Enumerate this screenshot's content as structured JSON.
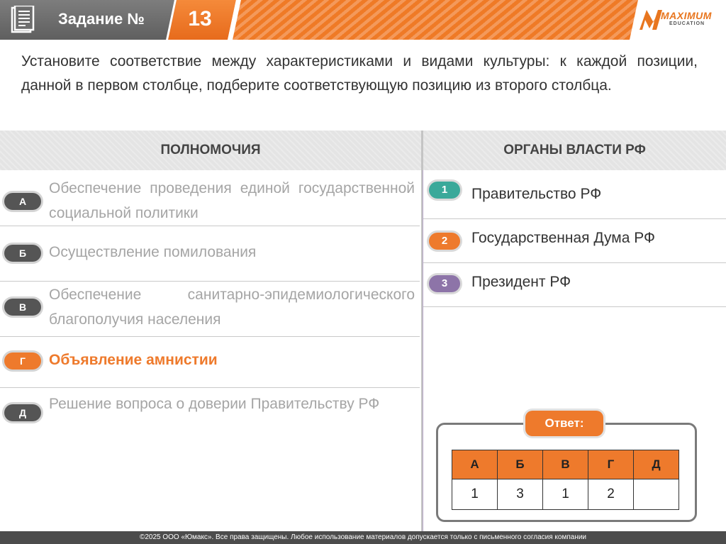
{
  "header": {
    "title": "Задание №",
    "number": "13",
    "logo_word": "MAXIMUM",
    "logo_sub": "EDUCATION"
  },
  "question": "Установите соответствие между характеристиками и видами культуры: к каждой позиции, данной в первом столбце, подберите соответствующую позицию из второго столбца.",
  "left_column": {
    "header": "ПОЛНОМОЧИЯ",
    "items": [
      {
        "letter": "А",
        "text": "Обеспечение проведения единой государственной социальной политики"
      },
      {
        "letter": "Б",
        "text": "Осуществление помилования"
      },
      {
        "letter": "В",
        "text": "Обеспечение санитарно-эпидемиологического благополучия населения"
      },
      {
        "letter": "Г",
        "text": "Объявление амнистии",
        "highlighted": true
      },
      {
        "letter": "Д",
        "text": "Решение вопроса о доверии Правительству РФ"
      }
    ]
  },
  "right_column": {
    "header": "ОРГАНЫ ВЛАСТИ РФ",
    "items": [
      {
        "number": "1",
        "text": "Правительство РФ",
        "color": "#3aa99a"
      },
      {
        "number": "2",
        "text": "Государственная Дума РФ",
        "color": "#ee7a2c"
      },
      {
        "number": "3",
        "text": "Президент РФ",
        "color": "#8d74a8"
      }
    ]
  },
  "answer": {
    "label": "Ответ:",
    "headers": [
      "А",
      "Б",
      "В",
      "Г",
      "Д"
    ],
    "values": [
      "1",
      "3",
      "1",
      "2",
      ""
    ]
  },
  "footer": "©2025 ООО «Юмакс». Все права защищены. Любое использование материалов допускается только с  письменного согласия компании",
  "colors": {
    "accent": "#ee7a2c",
    "dark": "#555555",
    "teal": "#3aa99a",
    "purple": "#8d74a8"
  }
}
